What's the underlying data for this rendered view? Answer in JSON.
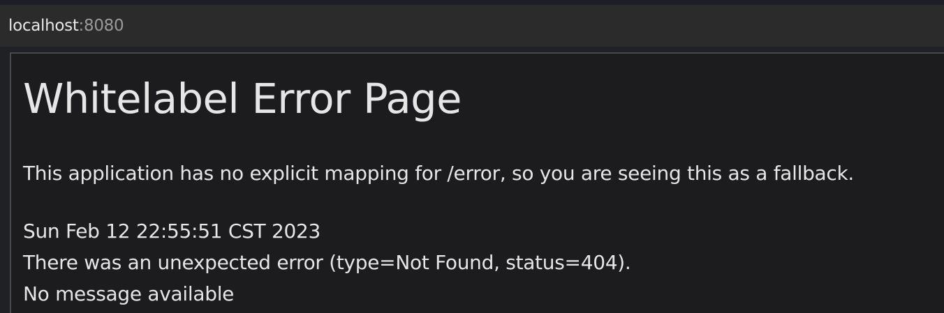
{
  "address_bar": {
    "host": "localhost",
    "port": ":8080"
  },
  "page": {
    "title": "Whitelabel Error Page",
    "fallback_message": "This application has no explicit mapping for /error, so you are seeing this as a fallback.",
    "timestamp": "Sun Feb 12 22:55:51 CST 2023",
    "error_line": "There was an unexpected error (type=Not Found, status=404).",
    "message": "No message available"
  },
  "colors": {
    "background": "#1c1c1e",
    "text": "#e6e6e6",
    "address_bar_bg": "#2b2b2b",
    "port_text": "#9a9a9a"
  }
}
